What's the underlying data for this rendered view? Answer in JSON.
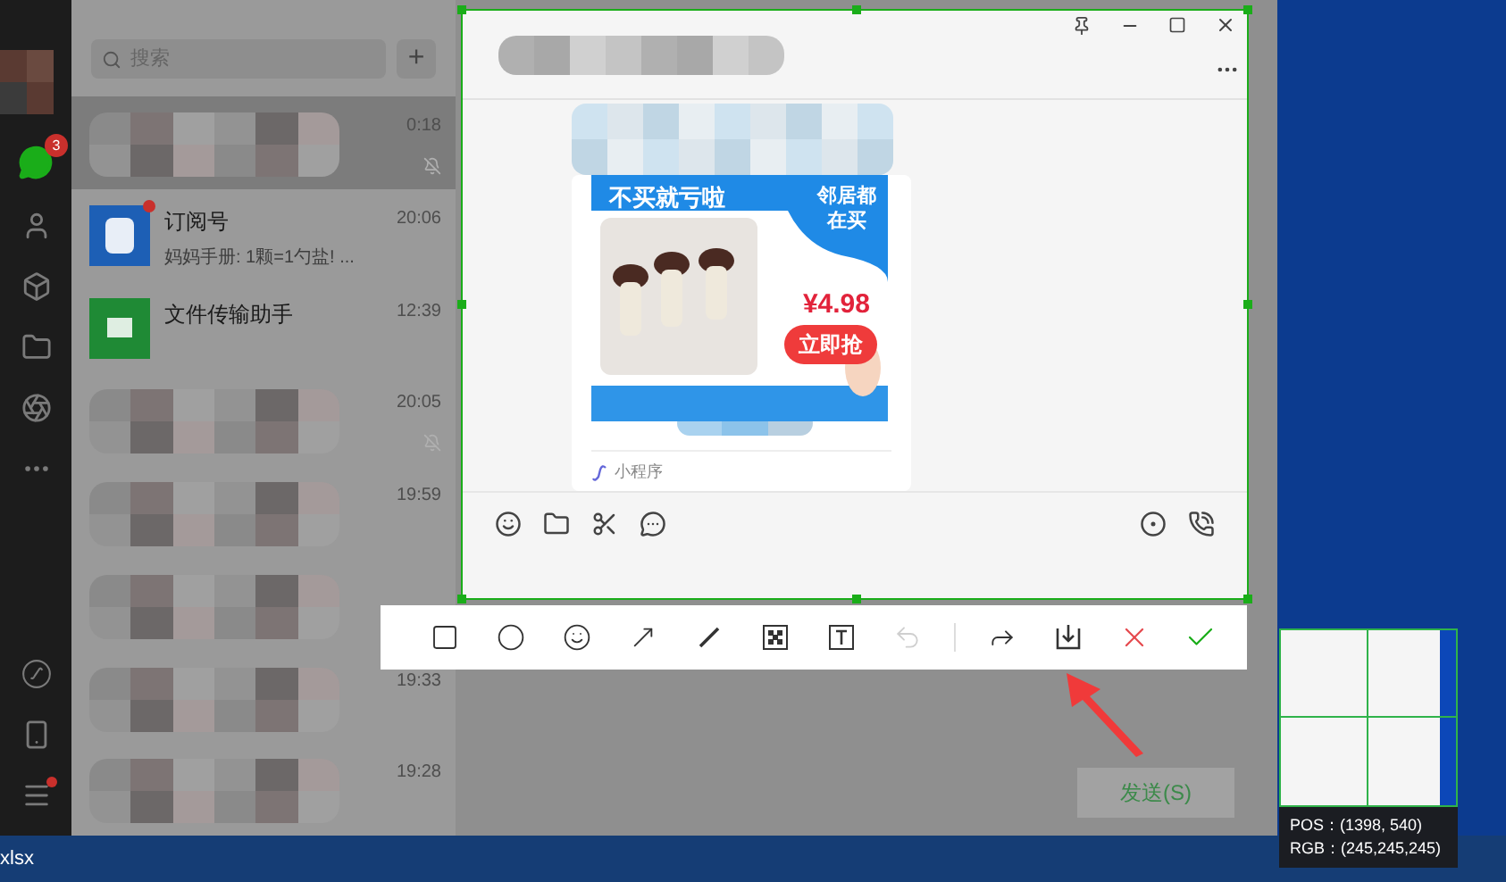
{
  "sidebar": {
    "unread_badge": "3",
    "menu_dot": true
  },
  "search": {
    "placeholder": "搜索",
    "add_button": "+"
  },
  "chats": [
    {
      "kind": "blurred",
      "time": "0:18",
      "selected": true,
      "muted": true
    },
    {
      "kind": "subscription",
      "name": "订阅号",
      "preview": "妈妈手册: 1颗=1勺盐! ...",
      "time": "20:06",
      "selected": false,
      "unread_dot": true
    },
    {
      "kind": "file",
      "name": "文件传输助手",
      "time": "12:39",
      "selected": false
    },
    {
      "kind": "blurred",
      "time": "20:05",
      "selected": false,
      "muted": true
    },
    {
      "kind": "blurred",
      "time": "19:59",
      "selected": false
    },
    {
      "kind": "blurred",
      "selected": false
    },
    {
      "kind": "blurred",
      "time": "19:33",
      "selected": false
    },
    {
      "kind": "blurred",
      "time": "19:28",
      "selected": false
    }
  ],
  "message_card": {
    "banner_title": "不买就亏啦",
    "badge": "邻居都在买",
    "price": "¥4.98",
    "buy_button": "立即抢",
    "source": "小程序"
  },
  "send_button": "发送(S)",
  "tools": [
    {
      "kind": "rectangle"
    },
    {
      "kind": "ellipse"
    },
    {
      "kind": "emoji"
    },
    {
      "kind": "arrow"
    },
    {
      "kind": "pen"
    },
    {
      "kind": "mosaic"
    },
    {
      "kind": "text"
    },
    {
      "kind": "undo",
      "disabled": true
    },
    {
      "kind": "separator"
    },
    {
      "kind": "share"
    },
    {
      "kind": "save"
    },
    {
      "kind": "cancel"
    },
    {
      "kind": "confirm"
    }
  ],
  "magnifier": {
    "position": "POS：(1398, 540)",
    "rgb_reading": "RGB：(245,245,245)"
  },
  "taskbar": {
    "file": "xlsx"
  }
}
